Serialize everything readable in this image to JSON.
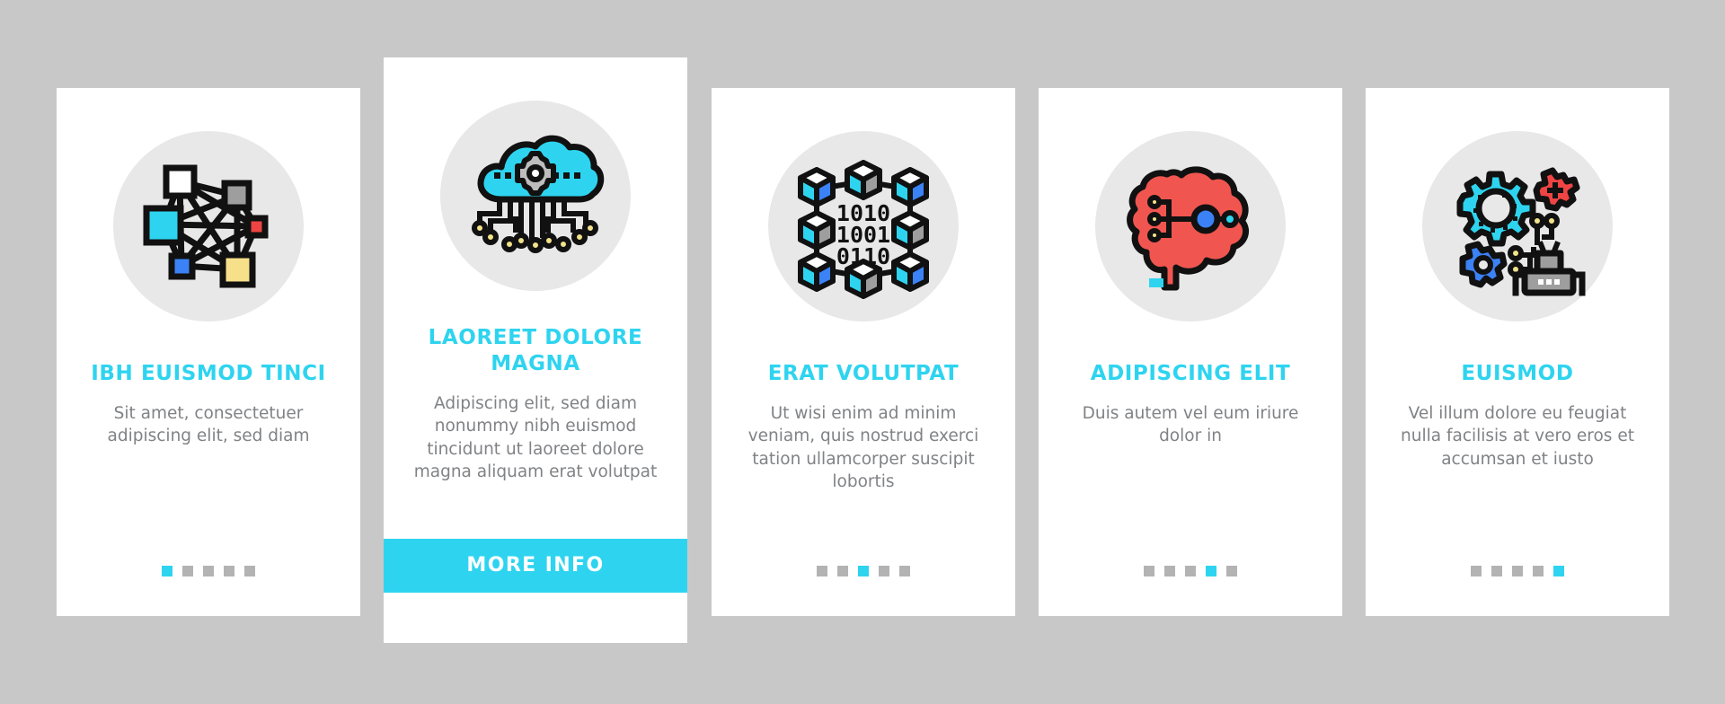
{
  "page": {
    "background_color": "#c8c8c8",
    "card_background": "#ffffff",
    "accent_color": "#2ed4ef",
    "title_color": "#2ed4ef",
    "body_text_color": "#808285",
    "icon_circle_color": "#e8e8e8",
    "dot_inactive_color": "#b3b3b3"
  },
  "cards": [
    {
      "icon_name": "network-mesh-icon",
      "title": "IBH EUISMOD TINCI",
      "body": "Sit amet, consectetuer adipiscing elit, sed diam",
      "dots": {
        "count": 5,
        "active_index": 0
      },
      "has_button": false,
      "button_label": ""
    },
    {
      "icon_name": "cloud-computing-gear-icon",
      "title": "LAOREET DOLORE MAGNA",
      "body": "Adipiscing elit, sed diam nonummy nibh euismod tincidunt ut laoreet dolore magna aliquam erat volutpat",
      "dots": {
        "count": 0,
        "active_index": -1
      },
      "has_button": true,
      "button_label": "MORE INFO"
    },
    {
      "icon_name": "blockchain-binary-icon",
      "title": "ERAT VOLUTPAT",
      "body": "Ut wisi enim ad minim veniam, quis nostrud exerci tation ullamcorper suscipit lobortis",
      "dots": {
        "count": 5,
        "active_index": 2
      },
      "has_button": false,
      "button_label": ""
    },
    {
      "icon_name": "brain-neural-network-icon",
      "title": "ADIPISCING ELIT",
      "body": "Duis autem vel eum iriure dolor in",
      "dots": {
        "count": 5,
        "active_index": 3
      },
      "has_button": false,
      "button_label": ""
    },
    {
      "icon_name": "gears-robot-automation-icon",
      "title": "EUISMOD",
      "body": "Vel illum dolore eu feugiat nulla facilisis at vero eros et accumsan et iusto",
      "dots": {
        "count": 5,
        "active_index": 4
      },
      "has_button": false,
      "button_label": ""
    }
  ],
  "icon_colors": {
    "cyan": "#2ed4ef",
    "blue": "#3b82f6",
    "red": "#ef4444",
    "yellow": "#f7e08a",
    "gray": "#9e9e9e",
    "white": "#ffffff",
    "black": "#111111",
    "brain_red": "#f0564f",
    "dot_yellow": "#f2e28a"
  }
}
